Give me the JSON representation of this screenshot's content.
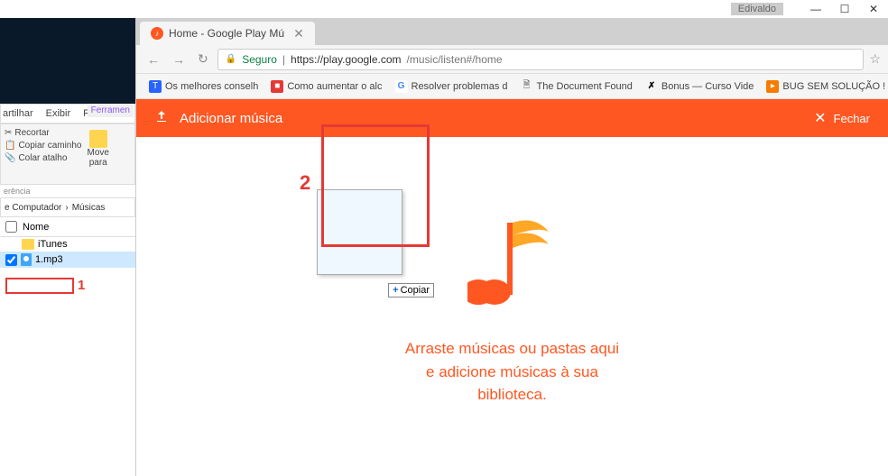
{
  "win": {
    "user": "Edivaldo",
    "min": "—",
    "max": "☐",
    "close": "✕"
  },
  "chrome": {
    "tab_title": "Home - Google Play Mú",
    "tab_close": "✕",
    "nav_back": "←",
    "nav_fwd": "→",
    "nav_reload": "↻",
    "seguro": "Seguro",
    "url_host": "https://play.google.com",
    "url_path": "/music/listen#/home",
    "star": "☆",
    "bookmarks": [
      {
        "icon_class": "blue",
        "icon": "T",
        "label": "Os melhores conselh"
      },
      {
        "icon_class": "red",
        "icon": "■",
        "label": "Como aumentar o alc"
      },
      {
        "icon_class": "g",
        "icon": "G",
        "label": "Resolver problemas d"
      },
      {
        "icon_class": "doc",
        "icon": "🗎",
        "label": "The Document Found"
      },
      {
        "icon_class": "x",
        "icon": "✗",
        "label": "Bonus — Curso Vide"
      },
      {
        "icon_class": "bug",
        "icon": "▸",
        "label": "BUG SEM SOLUÇÃO !"
      }
    ]
  },
  "modal": {
    "title": "Adicionar música",
    "upload_icon": "⬆",
    "close_icon": "✕",
    "close_label": "Fechar",
    "drop_text_1": "Arraste músicas ou pastas aqui",
    "drop_text_2": "e adicione músicas à sua",
    "drop_text_3": "biblioteca."
  },
  "drag": {
    "plus": "+",
    "label": "Copiar"
  },
  "explorer": {
    "menu": {
      "artilhar": "artilhar",
      "exibir": "Exibir",
      "r": "R",
      "ferramen": "Ferramen"
    },
    "ribbon": {
      "recortar": "Recortar",
      "copiar_caminho": "Copiar caminho",
      "colar_atalho": "Colar atalho",
      "move": "Move",
      "para": "para"
    },
    "group_label": "erência",
    "breadcrumb": {
      "computador": "e Computador",
      "sep": "›",
      "musicas": "Músicas"
    },
    "col_name": "Nome",
    "items": {
      "itunes": "iTunes",
      "mp3": "1.mp3"
    }
  },
  "annotations": {
    "n1": "1",
    "n2": "2"
  }
}
